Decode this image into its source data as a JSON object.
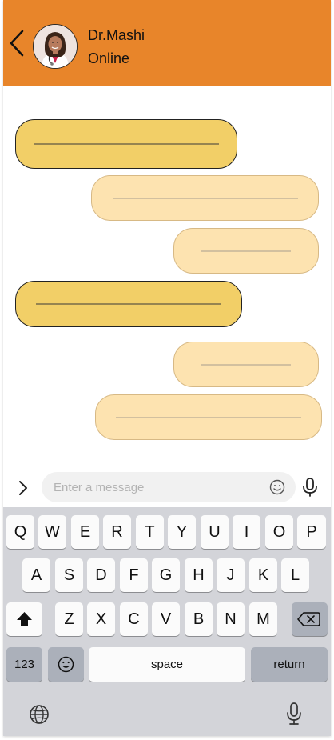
{
  "header": {
    "name": "Dr.Mashi",
    "status": "Online",
    "background_color": "#e8852a"
  },
  "chat": {
    "incoming_color": "#f2cf67",
    "outgoing_color": "#fde3b0"
  },
  "composer": {
    "placeholder": "Enter a message"
  },
  "keyboard": {
    "row1": [
      "Q",
      "W",
      "E",
      "R",
      "T",
      "Y",
      "U",
      "I",
      "O",
      "P"
    ],
    "row2": [
      "A",
      "S",
      "D",
      "F",
      "G",
      "H",
      "J",
      "K",
      "L"
    ],
    "row3": [
      "Z",
      "X",
      "C",
      "V",
      "B",
      "N",
      "M"
    ],
    "numbers_label": "123",
    "space_label": "space",
    "return_label": "return"
  },
  "icons": [
    "back-icon",
    "avatar",
    "chevron-right-icon",
    "emoji-icon",
    "microphone-icon",
    "shift-icon",
    "backspace-icon",
    "emoji-key-icon",
    "globe-icon",
    "dictation-icon"
  ]
}
